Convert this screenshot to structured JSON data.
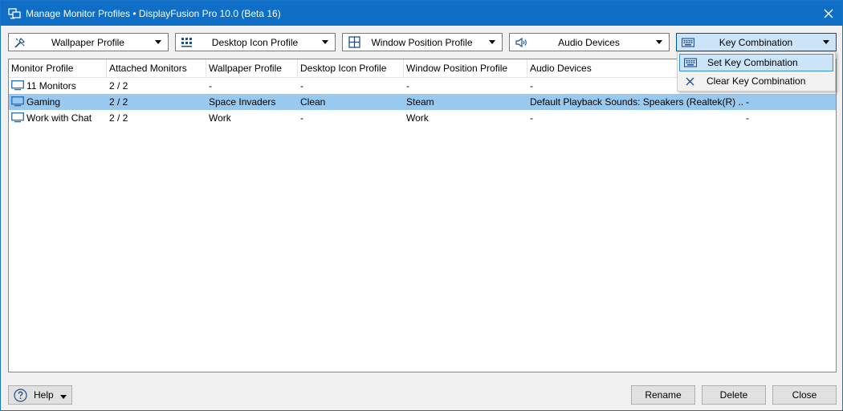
{
  "window": {
    "title": "Manage Monitor Profiles • DisplayFusion Pro 10.0 (Beta 16)",
    "accent_color": "#0f6fc6"
  },
  "toolbar": {
    "dropdowns": [
      {
        "label": "Wallpaper Profile",
        "icon": "wallpaper-icon"
      },
      {
        "label": "Desktop Icon Profile",
        "icon": "desktop-icons-icon"
      },
      {
        "label": "Window Position Profile",
        "icon": "window-position-icon"
      },
      {
        "label": "Audio Devices",
        "icon": "speaker-icon"
      },
      {
        "label": "Key Combination",
        "icon": "keyboard-icon"
      }
    ]
  },
  "menu": {
    "items": [
      {
        "label": "Set Key Combination",
        "icon": "keyboard-icon"
      },
      {
        "label": "Clear Key Combination",
        "icon": "close-icon"
      }
    ]
  },
  "list": {
    "columns": [
      "Monitor Profile",
      "Attached Monitors",
      "Wallpaper Profile",
      "Desktop Icon Profile",
      "Window Position Profile",
      "Audio Devices"
    ],
    "rows": [
      {
        "name": "11 Monitors",
        "attached": "2 / 2",
        "wallpaper": "-",
        "desktop_icon": "-",
        "window_position": "-",
        "audio": "-",
        "key": ""
      },
      {
        "name": "Gaming",
        "attached": "2 / 2",
        "wallpaper": "Space Invaders",
        "desktop_icon": "Clean",
        "window_position": "Steam",
        "audio": "Default Playback Sounds: Speakers (Realtek(R) ...",
        "key": "-"
      },
      {
        "name": "Work with Chat",
        "attached": "2 / 2",
        "wallpaper": "Work",
        "desktop_icon": "-",
        "window_position": "Work",
        "audio": "-",
        "key": "-"
      }
    ],
    "selected_row": 1,
    "selected_color": "#99c9ef"
  },
  "footer": {
    "help_label": "Help",
    "rename_label": "Rename",
    "delete_label": "Delete",
    "close_label": "Close"
  }
}
